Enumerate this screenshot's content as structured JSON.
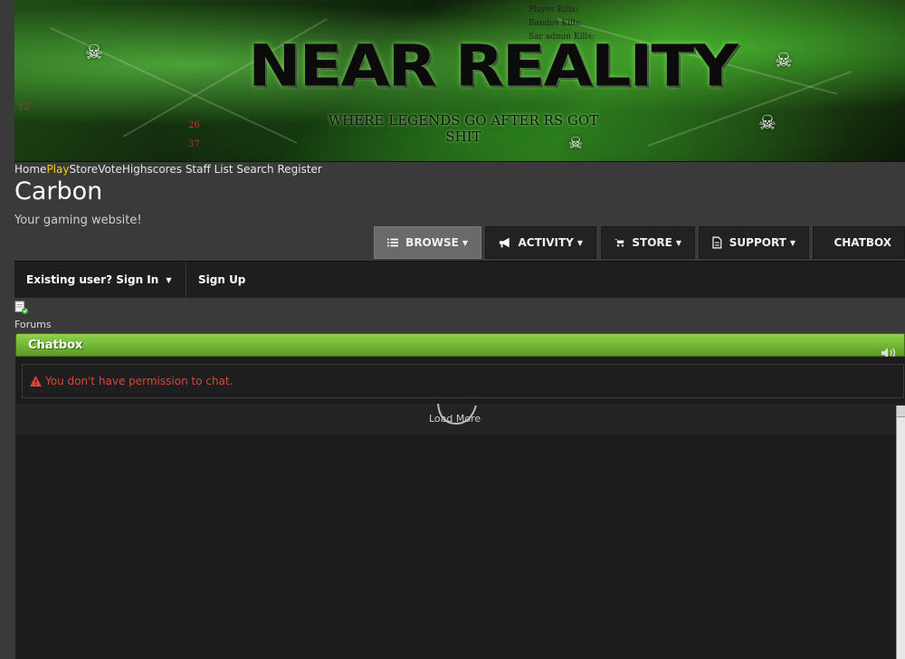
{
  "banner": {
    "title": "NEAR REALITY",
    "tagline": "WHERE LEGENDS GO AFTER RS GOT SHIT",
    "stats": [
      "Player Kills:",
      "Bandos Kills:",
      "Sar admin Kills:"
    ],
    "numbers": [
      "12",
      "26",
      "37"
    ]
  },
  "topnav": {
    "items": [
      "Home",
      "Play",
      "Store",
      "Vote",
      "Highscores",
      "Staff List",
      "Search",
      "Register"
    ]
  },
  "site": {
    "title": "Carbon",
    "subtitle": "Your gaming website!"
  },
  "mainnav": {
    "browse": "BROWSE",
    "activity": "ACTIVITY",
    "store": "STORE",
    "support": "SUPPORT",
    "chatbox": "CHATBOX"
  },
  "userbar": {
    "sign_in": "Existing user? Sign In",
    "sign_up": "Sign Up"
  },
  "breadcrumb": {
    "forums": "Forums"
  },
  "chatbox": {
    "title": "Chatbox",
    "permission_error": "You don't have permission to chat.",
    "load_more": "Load More"
  },
  "colors": {
    "chatbox_header": "#6fb330",
    "active_nav": "#f2d400",
    "error": "#d9463c"
  }
}
